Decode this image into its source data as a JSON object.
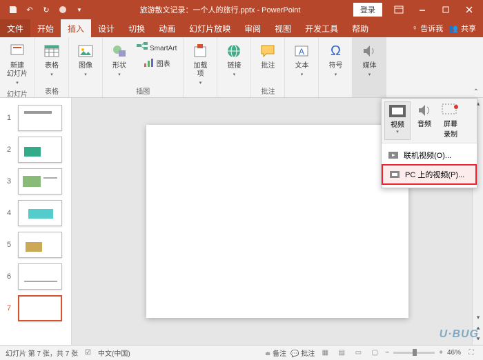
{
  "titlebar": {
    "title": "旅游散文记录：一个人的旅行.pptx - PowerPoint",
    "login": "登录"
  },
  "tabs": {
    "file": "文件",
    "home": "开始",
    "insert": "插入",
    "design": "设计",
    "transitions": "切换",
    "animations": "动画",
    "slideshow": "幻灯片放映",
    "review": "审阅",
    "view": "视图",
    "developer": "开发工具",
    "help": "帮助",
    "tellme": "告诉我",
    "share": "共享"
  },
  "ribbon": {
    "slides": {
      "new_slide": "新建\n幻灯片",
      "group": "幻灯片"
    },
    "tables": {
      "table": "表格",
      "group": "表格"
    },
    "images": {
      "image": "图像"
    },
    "illustrations": {
      "shapes": "形状",
      "smartart": "SmartArt",
      "chart": "图表",
      "group": "插图"
    },
    "addins": {
      "addin": "加载\n项"
    },
    "links": {
      "link": "链接"
    },
    "comments": {
      "comment": "批注",
      "group": "批注"
    },
    "text": {
      "textbox": "文本"
    },
    "symbols": {
      "symbol": "符号"
    },
    "media": {
      "media": "媒体"
    }
  },
  "media_menu": {
    "video": "视频",
    "audio": "音频",
    "screen": "屏幕\n录制",
    "online_video": "联机视频(O)...",
    "pc_video": "PC 上的视频(P)..."
  },
  "thumbs": [
    1,
    2,
    3,
    4,
    5,
    6,
    7
  ],
  "status": {
    "slide_info": "幻灯片 第 7 张，共 7 张",
    "lang": "中文(中国)",
    "notes": "备注",
    "comments": "批注",
    "zoom": "46%"
  },
  "watermark": "U·BUG"
}
